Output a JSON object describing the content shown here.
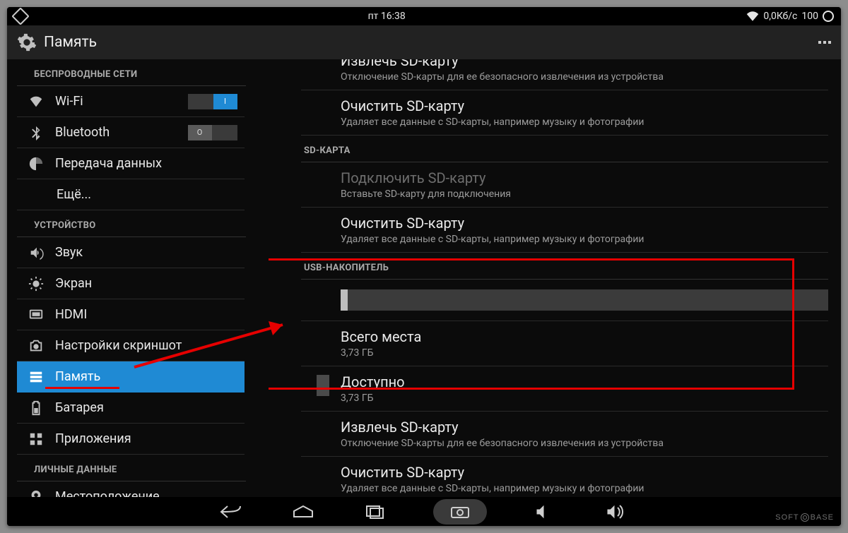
{
  "statusbar": {
    "time": "пт 16:38",
    "net": "0,0Кб/с",
    "battery": "100"
  },
  "header": {
    "title": "Память"
  },
  "sections": {
    "wireless": "БЕСПРОВОДНЫЕ СЕТИ",
    "device": "УСТРОЙСТВО",
    "personal": "ЛИЧНЫЕ ДАННЫЕ"
  },
  "side": {
    "wifi": "Wi-Fi",
    "wifi_on": "I",
    "bt": "Bluetooth",
    "bt_off": "O",
    "data": "Передача данных",
    "more": "Ещё...",
    "sound": "Звук",
    "display": "Экран",
    "hdmi": "HDMI",
    "screenshot": "Настройки скриншот",
    "storage": "Память",
    "battery": "Батарея",
    "apps": "Приложения",
    "location": "Местоположение"
  },
  "content": {
    "eject_partial_t": "Извлечь SD-карту",
    "eject_sub": "Отключение SD-карты для ее безопасного извлечения из устройства",
    "erase_t": "Очистить SD-карту",
    "erase_sub": "Удаляет все данные с SD-карты, например музыку и фотографии",
    "sec_sd": "SD-КАРТА",
    "mount_t": "Подключить SD-карту",
    "mount_sub": "Вставьте SD-карту для подключения",
    "sec_usb": "USB-НАКОПИТЕЛЬ",
    "total_t": "Всего места",
    "total_v": "3,73 ГБ",
    "avail_t": "Доступно",
    "avail_v": "3,73 ГБ"
  },
  "watermark": {
    "a": "SOFT",
    "b": "BASE"
  }
}
